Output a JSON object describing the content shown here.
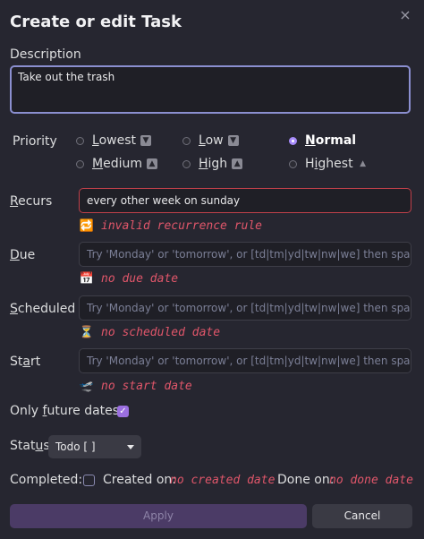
{
  "modal": {
    "title": "Create or edit Task",
    "close_glyph": "×"
  },
  "description": {
    "label": "Description",
    "value": "Take out the trash"
  },
  "priority": {
    "label": "Priority",
    "options": [
      {
        "label": "Lowest",
        "icon": "⏬",
        "selected": false
      },
      {
        "label": "Low",
        "icon": "🔽",
        "selected": false
      },
      {
        "label": "Normal",
        "icon": "",
        "selected": true
      },
      {
        "label": "Medium",
        "icon": "🔼",
        "selected": false
      },
      {
        "label": "High",
        "icon": "⏫",
        "selected": false
      },
      {
        "label": "Highest",
        "icon": "🔺",
        "selected": false
      }
    ]
  },
  "recurs": {
    "label": "Recurs",
    "value": "every other week on sunday",
    "hint_icon": "🔁",
    "hint": "invalid recurrence rule"
  },
  "due": {
    "label": "Due",
    "placeholder": "Try 'Monday' or 'tomorrow', or [td|tm|yd|tw|nw|we] then space.",
    "hint_icon": "📅",
    "hint": "no due date"
  },
  "scheduled": {
    "label": "Scheduled",
    "placeholder": "Try 'Monday' or 'tomorrow', or [td|tm|yd|tw|nw|we] then space.",
    "hint_icon": "⏳",
    "hint": "no scheduled date"
  },
  "start": {
    "label": "Start",
    "placeholder": "Try 'Monday' or 'tomorrow', or [td|tm|yd|tw|nw|we] then space.",
    "hint_icon": "🛫",
    "hint": "no start date"
  },
  "future_dates": {
    "label": "Only future dates:",
    "checked": true
  },
  "status": {
    "label": "Status",
    "value": "Todo [ ]"
  },
  "footer_row": {
    "completed_label": "Completed:",
    "created_label": "Created on:",
    "created_value": "no created date",
    "done_label": "Done on:",
    "done_value": "no done date"
  },
  "buttons": {
    "apply": "Apply",
    "cancel": "Cancel"
  },
  "colors": {
    "accent": "#a78bfa",
    "error": "#e0566a",
    "background": "#262630"
  }
}
